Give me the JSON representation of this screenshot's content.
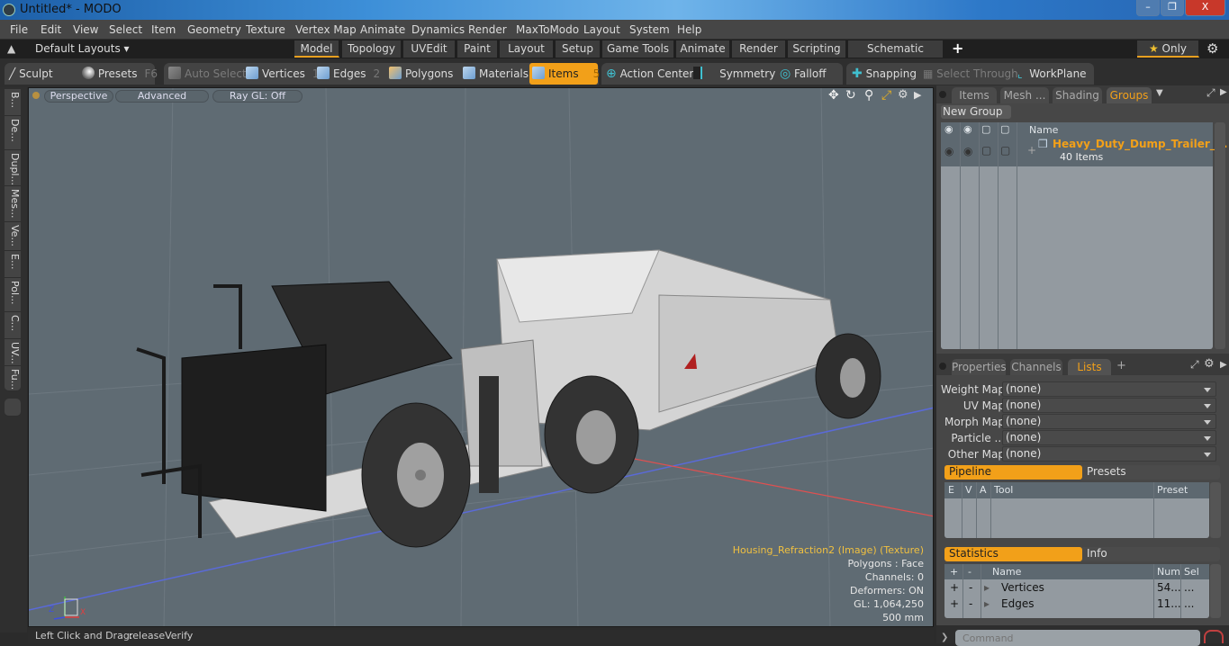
{
  "window": {
    "title": "Untitled* - MODO",
    "minimize": "–",
    "restore": "❐",
    "close": "X"
  },
  "menu": [
    "File",
    "Edit",
    "View",
    "Select",
    "Item",
    "Geometry",
    "Texture",
    "Vertex Map",
    "Animate",
    "Dynamics",
    "Render",
    "MaxToModo",
    "Layout",
    "System",
    "Help"
  ],
  "layouts": {
    "selector": "Default Layouts ▾",
    "tabs": [
      "Model",
      "Topology",
      "UVEdit",
      "Paint",
      "Layout",
      "Setup",
      "Game Tools",
      "Animate",
      "Render",
      "Scripting",
      "Schematic Fusion"
    ],
    "active": "Model",
    "add": "+",
    "only": "★ Only"
  },
  "toolbar": {
    "sculpt": "Sculpt",
    "presets": "Presets",
    "presets_key": "F6",
    "auto_select": "Auto Select",
    "vertices": "Vertices",
    "vertices_key": "1",
    "edges": "Edges",
    "edges_key": "2",
    "polygons": "Polygons",
    "materials": "Materials",
    "items": "Items",
    "items_key": "5",
    "action_center": "Action Center",
    "symmetry": "Symmetry",
    "falloff": "Falloff",
    "snapping": "Snapping",
    "select_through": "Select Through",
    "workplane": "WorkPlane"
  },
  "left_tabs": [
    "B...",
    "De...",
    "Dupl...",
    "Mes...",
    "Ve...",
    "E...",
    "Pol...",
    "C...",
    "UV...",
    "Fu..."
  ],
  "viewport": {
    "view": "Perspective",
    "shading": "Advanced",
    "raygl": "Ray GL: Off",
    "hud": {
      "texture": "Housing_Refraction2 (Image) (Texture)",
      "polygons": "Polygons : Face",
      "channels": "Channels: 0",
      "deformers": "Deformers: ON",
      "gl": "GL: 1,064,250",
      "scale": "500 mm"
    },
    "axis": {
      "x": "X",
      "y": "Y",
      "z": "Z"
    }
  },
  "status": {
    "label": "Left Click and Drag:",
    "value": "releaseVerify"
  },
  "groups_panel": {
    "tabs": [
      "Items",
      "Mesh ...",
      "Shading",
      "Groups"
    ],
    "active": "Groups",
    "new_group": "New Group",
    "name_header": "Name",
    "group_name": "Heavy_Duty_Dump_Trailer_...",
    "group_count": "40 Items"
  },
  "lists_panel": {
    "tabs": [
      "Properties",
      "Channels",
      "Lists"
    ],
    "active": "Lists",
    "add": "+",
    "rows": [
      {
        "label": "Weight Map",
        "value": "(none)"
      },
      {
        "label": "UV Map",
        "value": "(none)"
      },
      {
        "label": "Morph Map",
        "value": "(none)"
      },
      {
        "label": "Particle  ...",
        "value": "(none)"
      },
      {
        "label": "Other Map",
        "value": "(none)"
      }
    ]
  },
  "pipeline": {
    "tabs": [
      "Pipeline",
      "Presets"
    ],
    "headers": [
      "E",
      "V",
      "A",
      "Tool",
      "Preset"
    ]
  },
  "statistics": {
    "tabs": [
      "Statistics",
      "Info"
    ],
    "headers": [
      "+",
      "-",
      "Name",
      "Num",
      "Sel"
    ],
    "rows": [
      {
        "plus": "+",
        "minus": "-",
        "name": "Vertices",
        "num": "54...",
        "sel": "..."
      },
      {
        "plus": "+",
        "minus": "-",
        "name": "Edges",
        "num": "11...",
        "sel": "..."
      }
    ]
  },
  "command": {
    "placeholder": "Command"
  }
}
